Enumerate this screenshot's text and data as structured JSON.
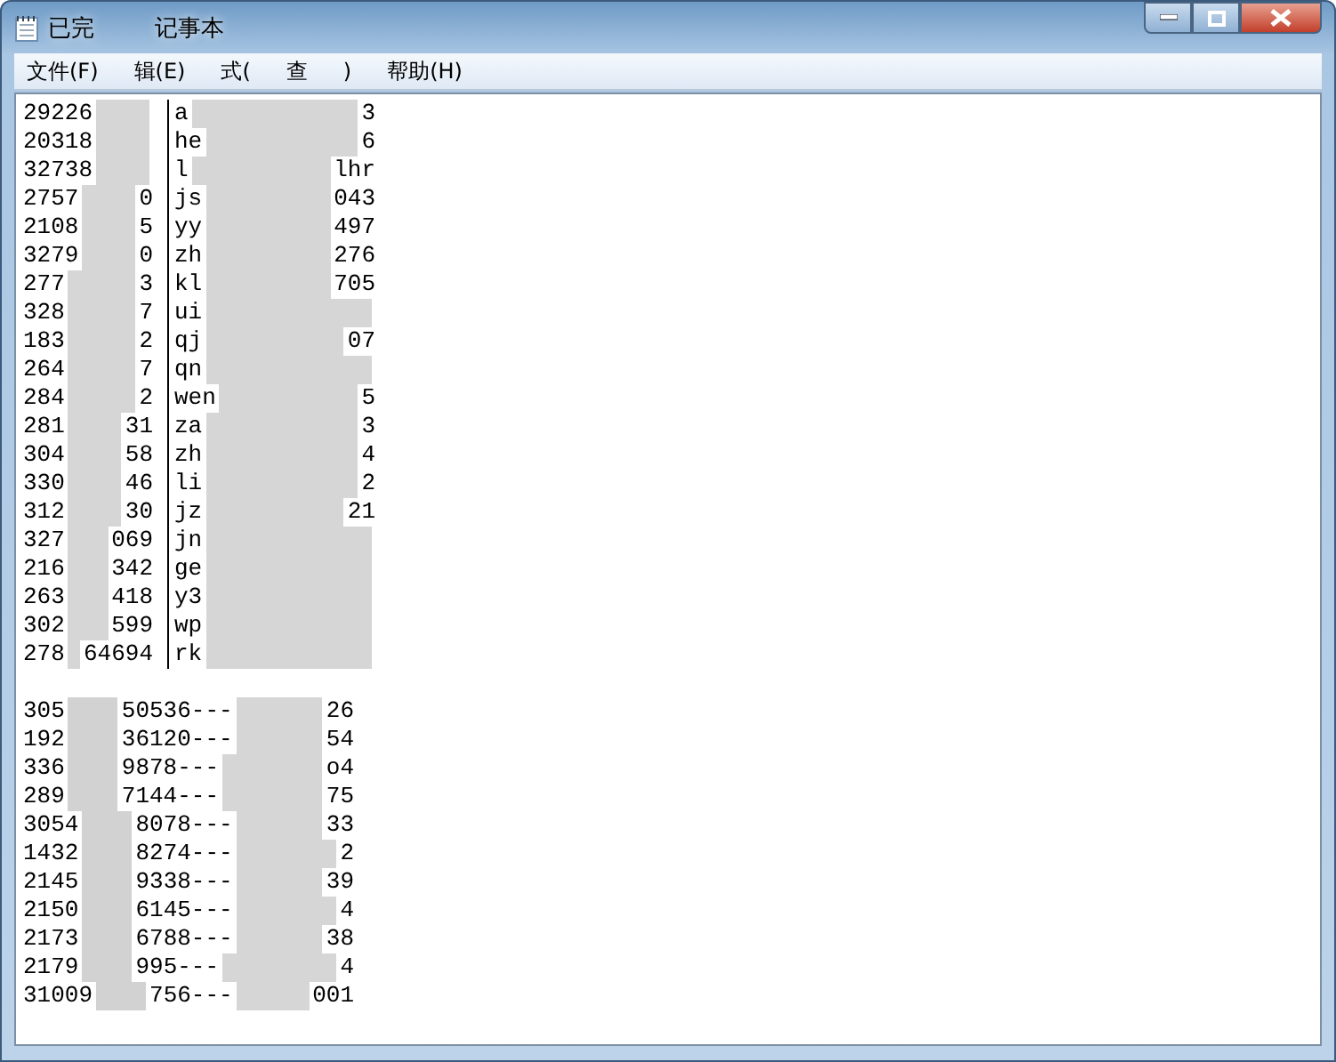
{
  "window": {
    "title_parts": [
      "已完",
      "记事本"
    ]
  },
  "menu": [
    {
      "label": "文件(F)"
    },
    {
      "label": "辑(E)"
    },
    {
      "label": "式("
    },
    {
      "label": "查"
    },
    {
      "label": ")"
    },
    {
      "label": "帮助(H)"
    }
  ],
  "table": {
    "rows": [
      {
        "column_1": [
          "29226"
        ],
        "column_2": [
          "a",
          "3"
        ]
      },
      {
        "column_1": [
          "20318"
        ],
        "column_2": [
          "he",
          "6"
        ]
      },
      {
        "column_1": [
          "32738"
        ],
        "column_2": [
          "l",
          "lhr"
        ]
      },
      {
        "column_1": [
          "2757",
          "0"
        ],
        "column_2": [
          "js",
          "043"
        ]
      },
      {
        "column_1": [
          "2108",
          "5"
        ],
        "column_2": [
          "yy",
          "497"
        ]
      },
      {
        "column_1": [
          "3279",
          "0"
        ],
        "column_2": [
          "zh",
          "276"
        ]
      },
      {
        "column_1": [
          "277",
          "3"
        ],
        "column_2": [
          "kl",
          "705"
        ]
      },
      {
        "column_1": [
          "328",
          "7"
        ],
        "column_2": [
          "ui"
        ]
      },
      {
        "column_1": [
          "183",
          "2"
        ],
        "column_2": [
          "qj",
          "07"
        ]
      },
      {
        "column_1": [
          "264",
          "7"
        ],
        "column_2": [
          "qn"
        ]
      },
      {
        "column_1": [
          "284",
          "2"
        ],
        "column_2": [
          "wen",
          "5"
        ]
      },
      {
        "column_1": [
          "281",
          "31"
        ],
        "column_2": [
          "za",
          "3"
        ]
      },
      {
        "column_1": [
          "304",
          "58"
        ],
        "column_2": [
          "zh",
          "4"
        ]
      },
      {
        "column_1": [
          "330",
          "46"
        ],
        "column_2": [
          "li",
          "2"
        ]
      },
      {
        "column_1": [
          "312",
          "30"
        ],
        "column_2": [
          "jz",
          "21"
        ]
      },
      {
        "column_1": [
          "327",
          "069"
        ],
        "column_2": [
          "jn"
        ]
      },
      {
        "column_1": [
          "216",
          "342"
        ],
        "column_2": [
          "ge"
        ]
      },
      {
        "column_1": [
          "263",
          "418"
        ],
        "column_2": [
          "y3"
        ]
      },
      {
        "column_1": [
          "302",
          "599"
        ],
        "column_2": [
          "wp"
        ]
      },
      {
        "column_1": [
          "278",
          "64694"
        ],
        "column_2": [
          "rk"
        ]
      }
    ]
  },
  "lines": [
    {
      "parts": [
        "305",
        "50536---",
        "26"
      ]
    },
    {
      "parts": [
        "192",
        "36120---",
        "54"
      ]
    },
    {
      "parts": [
        "336",
        "9878---",
        "o4"
      ]
    },
    {
      "parts": [
        "289",
        "7144---",
        "75"
      ]
    },
    {
      "parts": [
        "3054",
        "8078---",
        "33"
      ]
    },
    {
      "parts": [
        "1432",
        "8274---",
        "2"
      ]
    },
    {
      "parts": [
        "2145",
        "9338---",
        "39"
      ]
    },
    {
      "parts": [
        "2150",
        "6145---",
        "4"
      ]
    },
    {
      "parts": [
        "2173",
        "6788---",
        "38"
      ]
    },
    {
      "parts": [
        "2179",
        "995---",
        "4"
      ]
    },
    {
      "parts": [
        "31009",
        "756---",
        "001"
      ]
    }
  ]
}
